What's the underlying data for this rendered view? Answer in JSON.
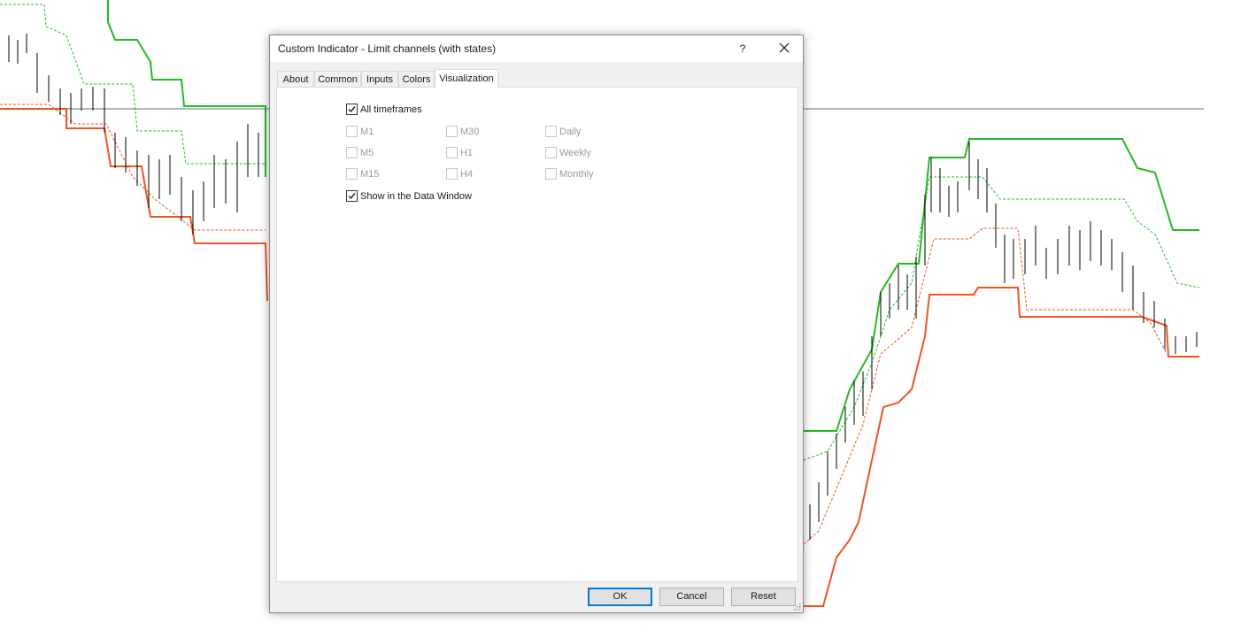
{
  "dialog": {
    "title": "Custom Indicator - Limit channels (with states)",
    "help_label": "?",
    "close_icon": "close-icon"
  },
  "tabs": [
    {
      "label": "About",
      "active": false
    },
    {
      "label": "Common",
      "active": false
    },
    {
      "label": "Inputs",
      "active": false
    },
    {
      "label": "Colors",
      "active": false
    },
    {
      "label": "Visualization",
      "active": true
    }
  ],
  "visualization": {
    "all_timeframes": {
      "label": "All timeframes",
      "checked": true
    },
    "timeframes": [
      {
        "label": "M1",
        "checked": false,
        "enabled": false
      },
      {
        "label": "M30",
        "checked": false,
        "enabled": false
      },
      {
        "label": "Daily",
        "checked": false,
        "enabled": false
      },
      {
        "label": "M5",
        "checked": false,
        "enabled": false
      },
      {
        "label": "H1",
        "checked": false,
        "enabled": false
      },
      {
        "label": "Weekly",
        "checked": false,
        "enabled": false
      },
      {
        "label": "M15",
        "checked": false,
        "enabled": false
      },
      {
        "label": "H4",
        "checked": false,
        "enabled": false
      },
      {
        "label": "Monthly",
        "checked": false,
        "enabled": false
      }
    ],
    "show_data_window": {
      "label": "Show in the Data Window",
      "checked": true
    }
  },
  "buttons": {
    "ok": "OK",
    "cancel": "Cancel",
    "reset": "Reset"
  },
  "colors": {
    "upper_channel": "#22bb22",
    "lower_channel": "#ee5522",
    "candles": "#000000",
    "accent": "#0078d7"
  }
}
